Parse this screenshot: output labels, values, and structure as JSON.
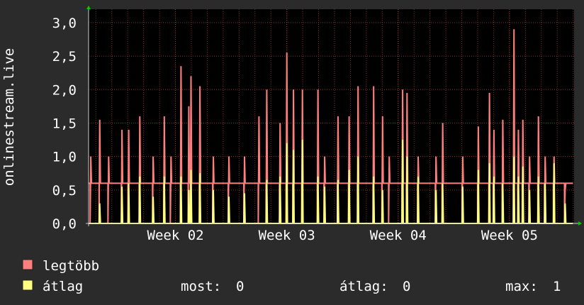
{
  "chart_data": {
    "type": "line",
    "ylabel": "onlinestream.live",
    "y_ticks": [
      "0,0",
      "0,5",
      "1,0",
      "1,5",
      "2,0",
      "2,5",
      "3,0"
    ],
    "y_tick_values": [
      0,
      0.5,
      1.0,
      1.5,
      2.0,
      2.5,
      3.0
    ],
    "ylim": [
      0,
      3.2
    ],
    "x_ticks": [
      "Week 02",
      "Week 03",
      "Week 04",
      "Week 05"
    ],
    "x_tick_positions": [
      2,
      3,
      4,
      5
    ],
    "xlim": [
      1.22,
      5.58
    ],
    "grid": true,
    "legend_placement": "bottom",
    "series": [
      {
        "name": "legtöbb",
        "color": "#ff7f7f",
        "peaks": [
          [
            1.24,
            1.0
          ],
          [
            1.32,
            1.55
          ],
          [
            1.4,
            1.0
          ],
          [
            1.52,
            1.4
          ],
          [
            1.58,
            1.4
          ],
          [
            1.68,
            1.6
          ],
          [
            1.8,
            1.0
          ],
          [
            1.9,
            1.6
          ],
          [
            1.96,
            1.0
          ],
          [
            2.05,
            2.35
          ],
          [
            2.12,
            1.75
          ],
          [
            2.14,
            2.2
          ],
          [
            2.22,
            2.05
          ],
          [
            2.34,
            1.0
          ],
          [
            2.48,
            1.0
          ],
          [
            2.62,
            1.0
          ],
          [
            2.75,
            1.6
          ],
          [
            2.82,
            2.0
          ],
          [
            2.94,
            1.5
          ],
          [
            3.0,
            2.55
          ],
          [
            3.06,
            2.0
          ],
          [
            3.14,
            2.0
          ],
          [
            3.28,
            2.0
          ],
          [
            3.34,
            1.0
          ],
          [
            3.46,
            1.6
          ],
          [
            3.56,
            1.6
          ],
          [
            3.64,
            2.05
          ],
          [
            3.78,
            2.05
          ],
          [
            3.86,
            1.6
          ],
          [
            3.92,
            1.0
          ],
          [
            4.04,
            2.0
          ],
          [
            4.08,
            1.95
          ],
          [
            4.18,
            1.0
          ],
          [
            4.34,
            1.0
          ],
          [
            4.4,
            1.5
          ],
          [
            4.58,
            1.0
          ],
          [
            4.72,
            1.45
          ],
          [
            4.82,
            1.95
          ],
          [
            4.86,
            1.4
          ],
          [
            4.94,
            1.55
          ],
          [
            5.04,
            2.9
          ],
          [
            5.08,
            1.4
          ],
          [
            5.12,
            1.55
          ],
          [
            5.18,
            1.0
          ],
          [
            5.26,
            1.6
          ],
          [
            5.32,
            1.0
          ],
          [
            5.4,
            1.0
          ],
          [
            5.5,
            0.5
          ]
        ],
        "floor": 0.6
      },
      {
        "name": "átlag",
        "color": "#ffff80",
        "peaks": [
          [
            1.32,
            0.3
          ],
          [
            1.52,
            0.55
          ],
          [
            1.58,
            0.6
          ],
          [
            1.68,
            0.7
          ],
          [
            1.8,
            0.4
          ],
          [
            1.9,
            0.7
          ],
          [
            2.05,
            0.7
          ],
          [
            2.12,
            0.5
          ],
          [
            2.14,
            0.8
          ],
          [
            2.22,
            0.75
          ],
          [
            2.34,
            0.5
          ],
          [
            2.48,
            0.4
          ],
          [
            2.62,
            0.45
          ],
          [
            2.82,
            0.65
          ],
          [
            2.94,
            0.7
          ],
          [
            3.0,
            1.2
          ],
          [
            3.06,
            1.1
          ],
          [
            3.14,
            1.25
          ],
          [
            3.28,
            0.7
          ],
          [
            3.34,
            0.55
          ],
          [
            3.46,
            0.65
          ],
          [
            3.56,
            0.8
          ],
          [
            3.64,
            1.0
          ],
          [
            3.78,
            0.7
          ],
          [
            3.86,
            0.5
          ],
          [
            4.04,
            1.25
          ],
          [
            4.08,
            1.0
          ],
          [
            4.18,
            0.7
          ],
          [
            4.34,
            0.5
          ],
          [
            4.4,
            0.6
          ],
          [
            4.58,
            0.55
          ],
          [
            4.72,
            0.8
          ],
          [
            4.82,
            0.9
          ],
          [
            4.86,
            0.7
          ],
          [
            4.94,
            0.6
          ],
          [
            5.04,
            1.0
          ],
          [
            5.08,
            0.7
          ],
          [
            5.12,
            0.85
          ],
          [
            5.18,
            0.5
          ],
          [
            5.26,
            0.7
          ],
          [
            5.32,
            0.6
          ],
          [
            5.4,
            0.9
          ],
          [
            5.5,
            0.3
          ]
        ],
        "floor": 0.0
      }
    ]
  },
  "legend": {
    "items": [
      {
        "label": "legtöbb",
        "color": "#ff7f7f"
      },
      {
        "label": "átlag",
        "color": "#ffff80"
      }
    ],
    "stats": {
      "most_label": "most:",
      "most_value": "0",
      "atlag_label": "átlag:",
      "atlag_value": "0",
      "max_label": "max:",
      "max_value": "1"
    }
  },
  "colors": {
    "background": "#2b2b2b",
    "canvas": "#000000",
    "grid": "#8b2d2d",
    "axis": "#cccccc",
    "arrow": "#00cc00"
  }
}
